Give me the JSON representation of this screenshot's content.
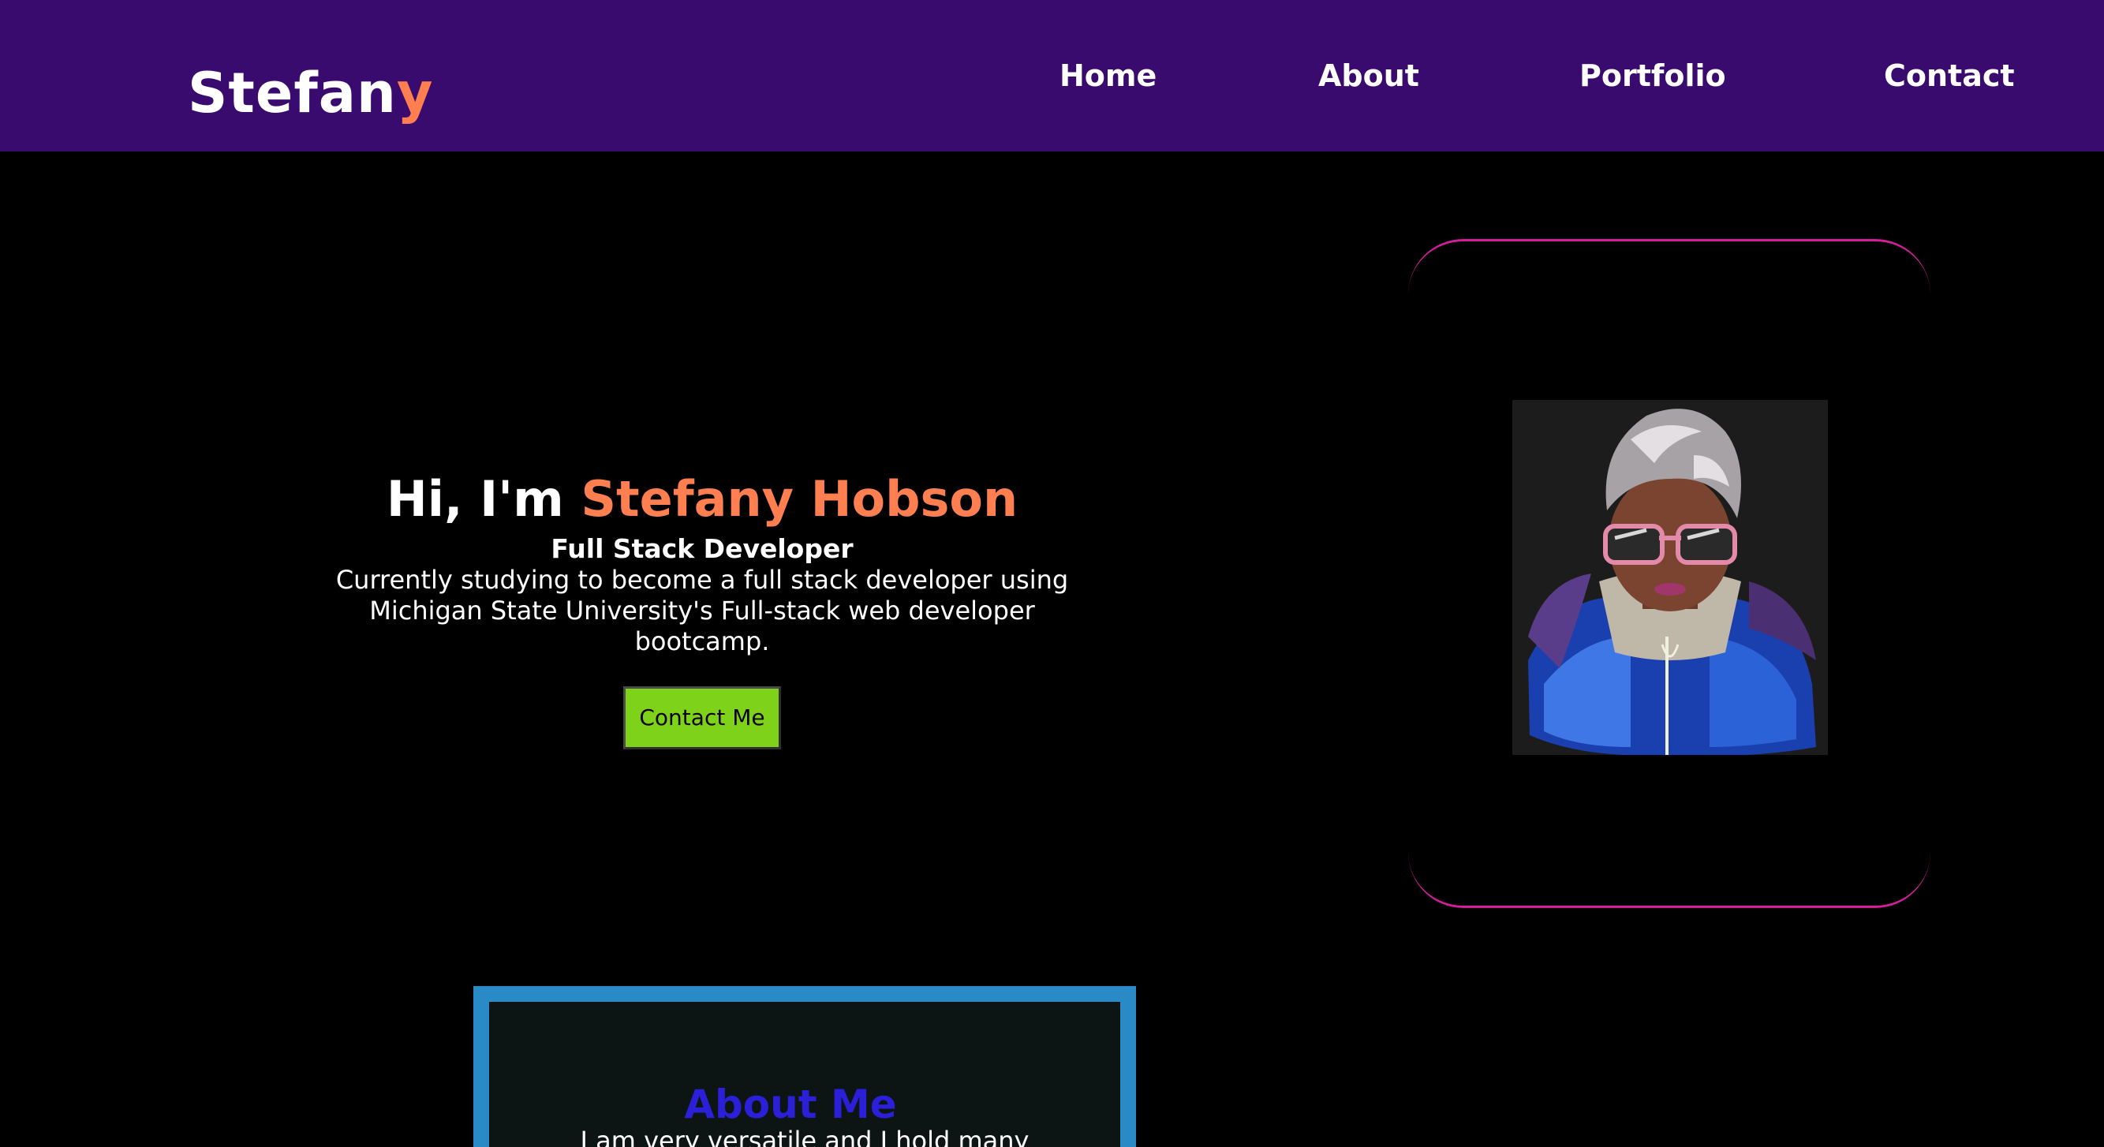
{
  "header": {
    "brand_main": "Stefan",
    "brand_accent": "y",
    "nav": [
      {
        "label": "Home"
      },
      {
        "label": "About"
      },
      {
        "label": "Portfolio"
      },
      {
        "label": "Contact"
      }
    ]
  },
  "hero": {
    "greeting": "Hi, I'm ",
    "name": "Stefany Hobson",
    "role": "Full Stack Developer",
    "description": "Currently studying to become a full stack developer using Michigan State University's Full-stack web developer bootcamp.",
    "button_label": "Contact Me"
  },
  "about": {
    "title": "About Me",
    "text": "I am very versatile and I hold many"
  },
  "colors": {
    "header_bg": "#3a0b6e",
    "accent": "#ff7f50",
    "button_bg": "#7ed31a",
    "card_border": "#d61e9c",
    "about_border": "#2a8ac6",
    "about_title": "#2b1fd8"
  }
}
